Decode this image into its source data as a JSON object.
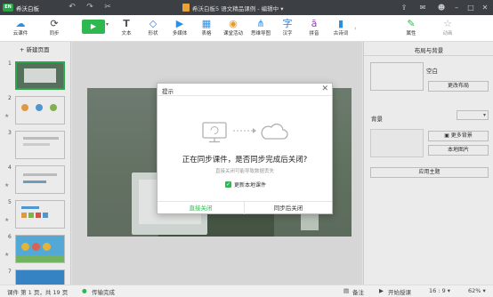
{
  "titlebar": {
    "app_name": "希沃白板",
    "logo_text": "EN",
    "doc_title": "希沃白板5 语文精品课例 - 编辑中 ▾"
  },
  "toolbar": {
    "cloud_label": "云课件",
    "sync_label": "同步",
    "tools": [
      {
        "label": "文本",
        "icon": "T"
      },
      {
        "label": "形状",
        "icon": "◇"
      },
      {
        "label": "多媒体",
        "icon": "▶"
      },
      {
        "label": "表格",
        "icon": "▦"
      },
      {
        "label": "课堂活动",
        "icon": "◉"
      },
      {
        "label": "思维导图",
        "icon": "⋔"
      },
      {
        "label": "汉字",
        "icon": "字"
      },
      {
        "label": "拼音",
        "icon": "ā"
      },
      {
        "label": "古诗词",
        "icon": "▮"
      }
    ],
    "attr_label": "属性",
    "anim_label": "动画"
  },
  "left_panel": {
    "new_page_label": "+ 新建页面",
    "pages": [
      "1",
      "2",
      "3",
      "4",
      "5",
      "6",
      "7"
    ]
  },
  "right_panel": {
    "title": "布局与背景",
    "blank_label": "空白",
    "change_layout": "更改布局",
    "background_label": "背景",
    "more_bg": "更多背景",
    "local_image": "本地图片",
    "apply_theme": "应用主题"
  },
  "dialog": {
    "title": "提示",
    "message": "正在同步课件，是否同步完成后关闭?",
    "sub": "直接关闭可能导致数据丢失",
    "checkbox_label": "更新本地课件",
    "checkbox_checked": true,
    "close_now": "直接关闭",
    "close_after_sync": "同步后关闭"
  },
  "statusbar": {
    "page_info": "课件 第 1 页，共 19 页",
    "transfer": "传输完成",
    "notes": "备注",
    "start_lesson": "开始授课",
    "ratio": "16 : 9 ▾",
    "zoom": "62% ▾"
  },
  "colors": {
    "accent_green": "#2fb84f",
    "titlebar_bg": "#3c3f44"
  }
}
